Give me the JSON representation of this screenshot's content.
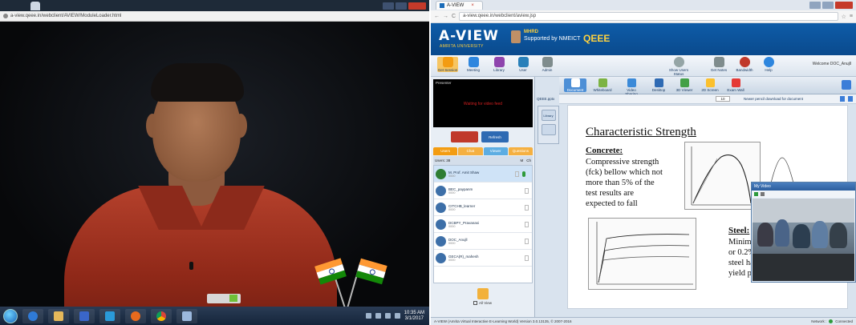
{
  "left_window": {
    "tab_title": "",
    "address": "a-view.qeee.in/webclient/AVIEW/ModuleLoader.html",
    "taskbar": {
      "clock_time": "10:35 AM",
      "clock_date": "3/1/2017"
    }
  },
  "right_window": {
    "tab_title": "A-VIEW",
    "address": "a-view.qeee.in/webclient/aview.jsp",
    "banner": {
      "logo": "A-VIEW",
      "logo_sub": "AMRITA UNIVERSITY",
      "mhrd": "MHRD",
      "supported": "Supported by NMEICT",
      "brand": "QEEE"
    },
    "toolbar": {
      "tools": [
        {
          "label": "Get Session",
          "color": "#f39c12"
        },
        {
          "label": "Meeting",
          "color": "#2e86de"
        },
        {
          "label": "Library",
          "color": "#8e44ad"
        },
        {
          "label": "User",
          "color": "#2980b9"
        },
        {
          "label": "Admin",
          "color": "#7f8c8d"
        }
      ],
      "right_tools": [
        {
          "label": "Show Users Status",
          "color": "#95a5a6"
        },
        {
          "label": "Get Notes",
          "color": "#7f8c8d"
        },
        {
          "label": "Bandwidth",
          "color": "#c0392b"
        },
        {
          "label": "Help",
          "color": "#2e86de"
        }
      ],
      "welcome": "Welcome DOC_Anujll"
    },
    "modules": [
      {
        "label": "Document",
        "color": "#5b8bd0"
      },
      {
        "label": "Whiteboard",
        "color": "#7cb342"
      },
      {
        "label": "Video Sharing",
        "color": "#3b8ad8"
      },
      {
        "label": "Desktop",
        "color": "#2e6ab3"
      },
      {
        "label": "3D Viewer",
        "color": "#43a047"
      },
      {
        "label": "2D Screen",
        "color": "#fbc02d"
      },
      {
        "label": "Exam Wall",
        "color": "#e53935"
      }
    ],
    "sidebar": {
      "presenter_label": "Presenter",
      "presenter_msg": "Waiting for video feed",
      "cam_btn1": "",
      "cam_btn2": "Refresh",
      "user_tabs": [
        {
          "label": "Users",
          "color": "#f39c12"
        },
        {
          "label": "Chat",
          "color": "#f5b041"
        },
        {
          "label": "Viewer",
          "color": "#5dade2"
        },
        {
          "label": "Questions",
          "color": "#f5b041"
        }
      ],
      "users_count": "Users: 38",
      "users_cols": [
        "M",
        "Ch"
      ],
      "users": [
        {
          "name": "M. Prof. Amit Shaw",
          "sub": "0000"
        },
        {
          "name": "BEC_paypanm",
          "sub": "0000"
        },
        {
          "name": "CITCHB_learner",
          "sub": "0000"
        },
        {
          "name": "DCBPY_Pravanasi",
          "sub": "0000"
        },
        {
          "name": "DOC_Anujll",
          "sub": "0000"
        },
        {
          "name": "GECA(R)_mahesh",
          "sub": "0000"
        }
      ],
      "all_view": "All View"
    },
    "content": {
      "tab": "QEEE.pptx",
      "page": "10",
      "download_msg": "Newer pencil download for document",
      "library_btn": "Library"
    },
    "slide": {
      "title": "Characteristic Strength",
      "concrete_heading": "Concrete:",
      "concrete_line1": "Compressive strength",
      "concrete_line2": "(fck) bellow which not",
      "concrete_line3": "more than 5% of the",
      "concrete_line4": "test results are",
      "concrete_line5": "expected to fall",
      "steel_heading": "Steel:",
      "steel_line1": "Minimum",
      "steel_line2": "or 0.2% o",
      "steel_line3": "steel hav",
      "steel_line4": "yield poin"
    },
    "my_video": {
      "title": "My Video"
    },
    "status_bar": {
      "left": "A-VIEW (Amrita Virtual Interactive E-Learning World) Version 3.0.13135, © 2007-2016",
      "right": "Network :",
      "conn": "Connected"
    }
  }
}
